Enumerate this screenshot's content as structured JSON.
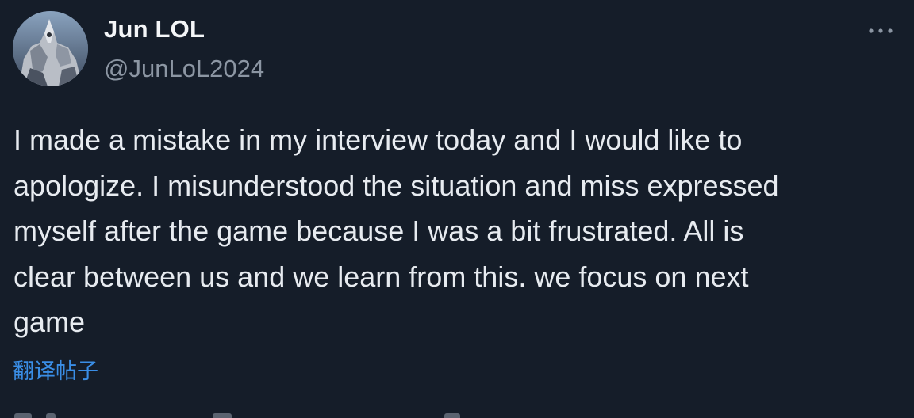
{
  "author": {
    "display_name": "Jun LOL",
    "handle": "@JunLoL2024",
    "avatar_icon": "avatar-image"
  },
  "more_icon": "more-icon",
  "tweet": {
    "text": "I made a mistake in my interview today and I would like to\napologize. I misunderstood the situation and miss expressed\nmyself after the game because I was a bit frustrated. All is\nclear between us and we learn from this. we focus on next\ngame",
    "translate_label": "翻译帖子"
  },
  "colors": {
    "background": "#151d29",
    "text": "#e7ebf0",
    "handle": "#8c96a3",
    "link": "#3a8ee6"
  }
}
